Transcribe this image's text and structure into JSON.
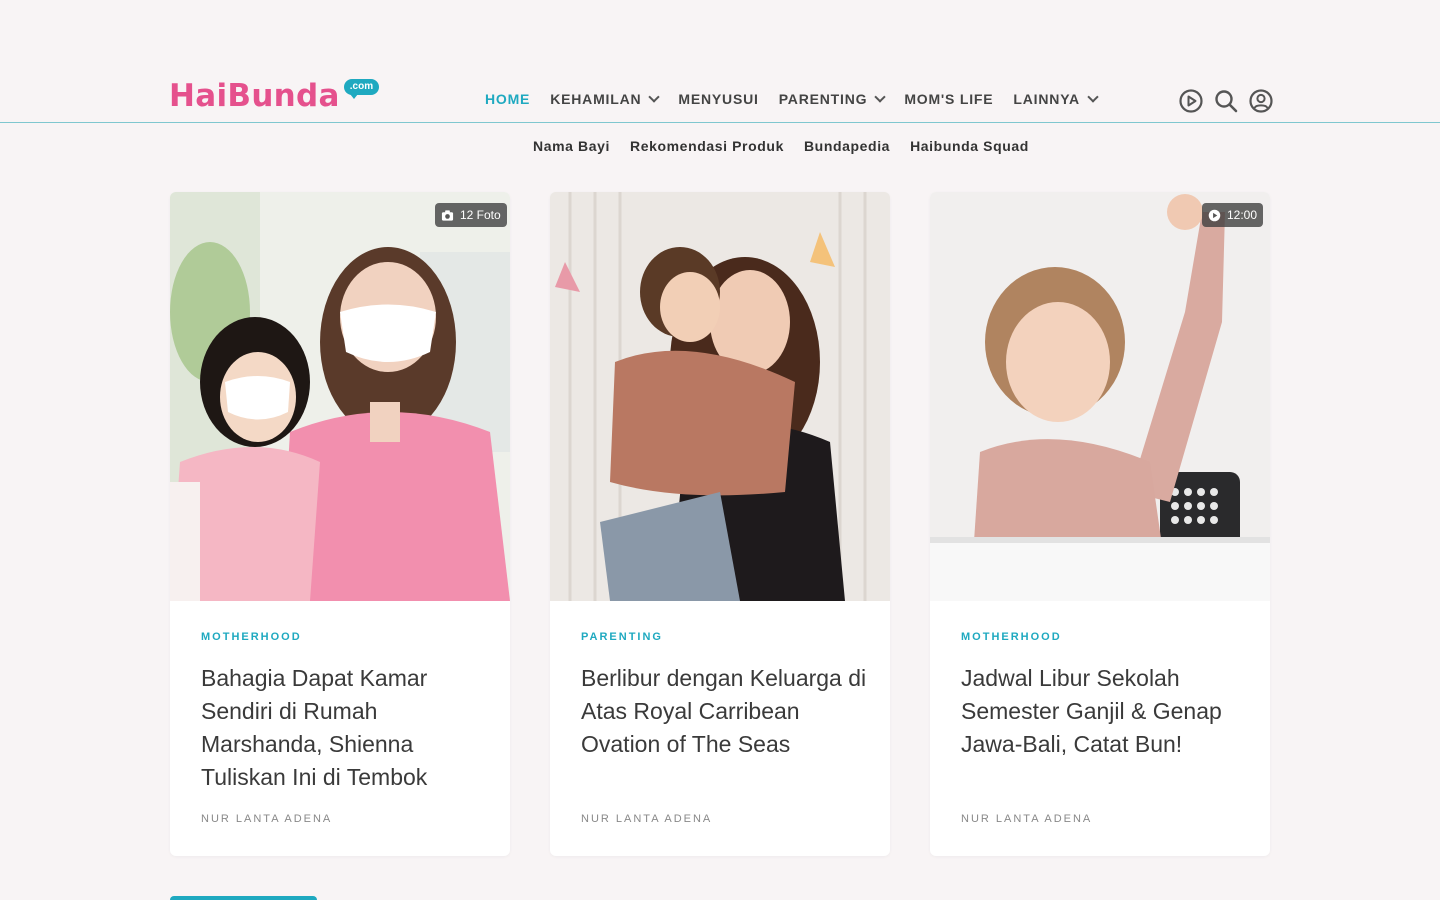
{
  "logo": {
    "text": "HaiBunda",
    "tld": ".com"
  },
  "nav": {
    "items": [
      {
        "label": "HOME",
        "active": true,
        "dropdown": false
      },
      {
        "label": "KEHAMILAN",
        "active": false,
        "dropdown": true
      },
      {
        "label": "MENYUSUI",
        "active": false,
        "dropdown": false
      },
      {
        "label": "PARENTING",
        "active": false,
        "dropdown": true
      },
      {
        "label": "MOM'S LIFE",
        "active": false,
        "dropdown": false
      },
      {
        "label": "LAINNYA",
        "active": false,
        "dropdown": true
      }
    ]
  },
  "header_icons": [
    "play-circle-icon",
    "search-icon",
    "user-icon"
  ],
  "subnav": {
    "items": [
      {
        "label": "Nama Bayi"
      },
      {
        "label": "Rekomendasi Produk"
      },
      {
        "label": "Bundapedia"
      },
      {
        "label": "Haibunda Squad"
      }
    ]
  },
  "cards": [
    {
      "badge_icon": "camera-icon",
      "badge_text": "12 Foto",
      "category": "MOTHERHOOD",
      "title": "Bahagia Dapat Kamar Sendiri di Rumah Marshanda, Shienna Tuliskan Ini di Tembok",
      "author": "NUR LANTA ADENA"
    },
    {
      "badge_icon": "",
      "badge_text": "",
      "category": "PARENTING",
      "title": "Berlibur dengan Keluarga di Atas Royal Carribean Ovation of The Seas",
      "author": "NUR LANTA ADENA"
    },
    {
      "badge_icon": "play-icon",
      "badge_text": "12:00",
      "category": "MOTHERHOOD",
      "title": "Jadwal Libur Sekolah Semester Ganjil & Genap Jawa-Bali, Catat Bun!",
      "author": "NUR LANTA ADENA"
    }
  ],
  "colors": {
    "accent": "#1fa9c0",
    "brand_pink": "#e5518d",
    "background": "#f8f4f5"
  }
}
